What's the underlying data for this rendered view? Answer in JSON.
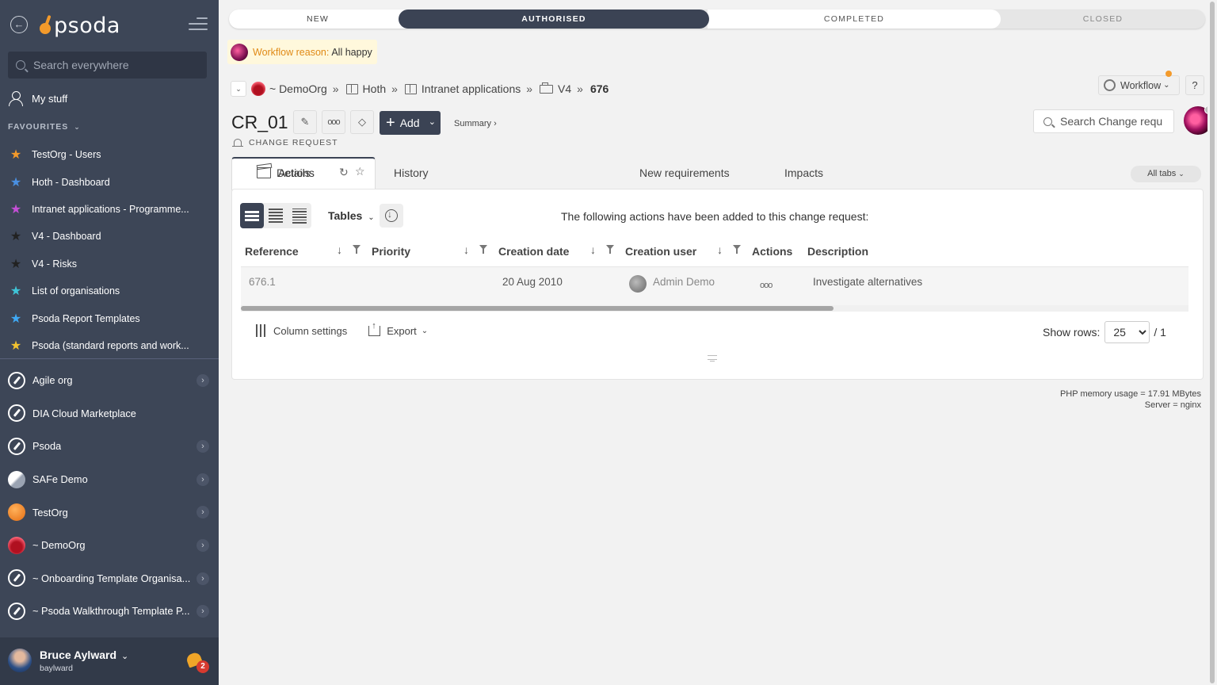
{
  "sidebar": {
    "logo_text": "psoda",
    "search_placeholder": "Search everywhere",
    "my_stuff": "My stuff",
    "favourites_heading": "FAVOURITES",
    "favourites": [
      {
        "label": "TestOrg - Users",
        "star_color": "#f39a2b"
      },
      {
        "label": "Hoth - Dashboard",
        "star_color": "#4a90e2"
      },
      {
        "label": "Intranet applications - Programme...",
        "star_color": "#c44fd6"
      },
      {
        "label": "V4 - Dashboard",
        "star_color": "#222222"
      },
      {
        "label": "V4 - Risks",
        "star_color": "#222222"
      },
      {
        "label": "List of organisations",
        "star_color": "#3fc5d8"
      },
      {
        "label": "Psoda Report Templates",
        "star_color": "#3fa9f5"
      },
      {
        "label": "Psoda (standard reports and work...",
        "star_color": "#f2c230"
      }
    ],
    "organisations": [
      {
        "label": "Agile org",
        "icon": "compass",
        "has_chevron": true
      },
      {
        "label": "DIA Cloud Marketplace",
        "icon": "compass",
        "has_chevron": false
      },
      {
        "label": "Psoda",
        "icon": "compass",
        "has_chevron": true
      },
      {
        "label": "SAFe Demo",
        "icon": "safe",
        "has_chevron": true
      },
      {
        "label": "TestOrg",
        "icon": "orange",
        "has_chevron": true
      },
      {
        "label": "~ DemoOrg",
        "icon": "demo",
        "has_chevron": true
      },
      {
        "label": "~ Onboarding Template Organisa...",
        "icon": "compass",
        "has_chevron": true
      },
      {
        "label": "~ Psoda Walkthrough Template P...",
        "icon": "compass",
        "has_chevron": true
      }
    ],
    "user": {
      "name": "Bruce Aylward",
      "login": "baylward",
      "notifications": "2"
    }
  },
  "workflow": {
    "steps": [
      "NEW",
      "AUTHORISED",
      "COMPLETED",
      "CLOSED"
    ],
    "current": "AUTHORISED",
    "reason_label": "Workflow reason:",
    "reason_value": "All happy"
  },
  "breadcrumb": {
    "items": [
      "~ DemoOrg",
      "Hoth",
      "Intranet applications",
      "V4"
    ],
    "current": "676"
  },
  "header": {
    "workflow_button": "Workflow",
    "help_button": "?",
    "title": "CR_01",
    "subtitle": "CHANGE REQUEST",
    "add_button": "Add",
    "summary_link": "Summary ›",
    "search_placeholder": "Search Change requ"
  },
  "tabs": {
    "items": [
      "Details",
      "History",
      "Actions",
      "New requirements",
      "Impacts"
    ],
    "active": "Actions",
    "all_tabs": "All tabs"
  },
  "panel": {
    "tables_label": "Tables",
    "message": "The following actions have been added to this change request:",
    "columns": [
      "Reference",
      "Priority",
      "Creation date",
      "Creation user",
      "Actions",
      "Description"
    ],
    "rows": [
      {
        "reference": "676.1",
        "priority": "",
        "creation_date": "20 Aug 2010",
        "creation_user": "Admin Demo",
        "description": "Investigate alternatives"
      }
    ],
    "column_settings": "Column settings",
    "export": "Export",
    "show_rows_label": "Show rows:",
    "show_rows_value": "25",
    "pages": "/ 1"
  },
  "server_info": {
    "memory": "PHP memory usage = 17.91 MBytes",
    "server": "Server = nginx"
  },
  "colors": {
    "sidebar_bg": "#3d4657",
    "accent_dark": "#3b4354",
    "brand_orange": "#f39a2b"
  }
}
